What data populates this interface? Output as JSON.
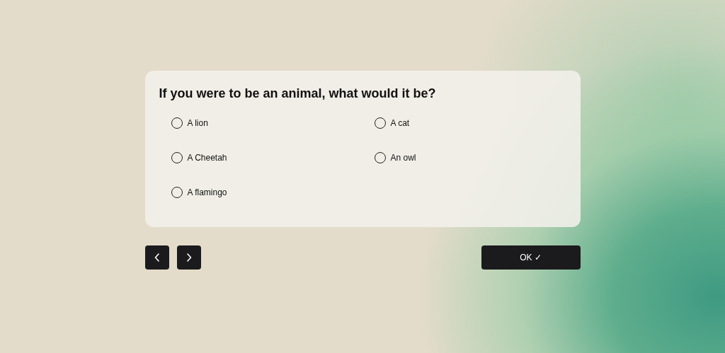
{
  "question": {
    "title": "If you were to be an animal, what would it be?",
    "options": [
      {
        "label": "A lion",
        "selected": false
      },
      {
        "label": "A cat",
        "selected": false
      },
      {
        "label": "A Cheetah",
        "selected": false
      },
      {
        "label": "An owl",
        "selected": false
      },
      {
        "label": "A flamingo",
        "selected": false
      }
    ]
  },
  "ok_button": {
    "label": "OK ✓"
  }
}
